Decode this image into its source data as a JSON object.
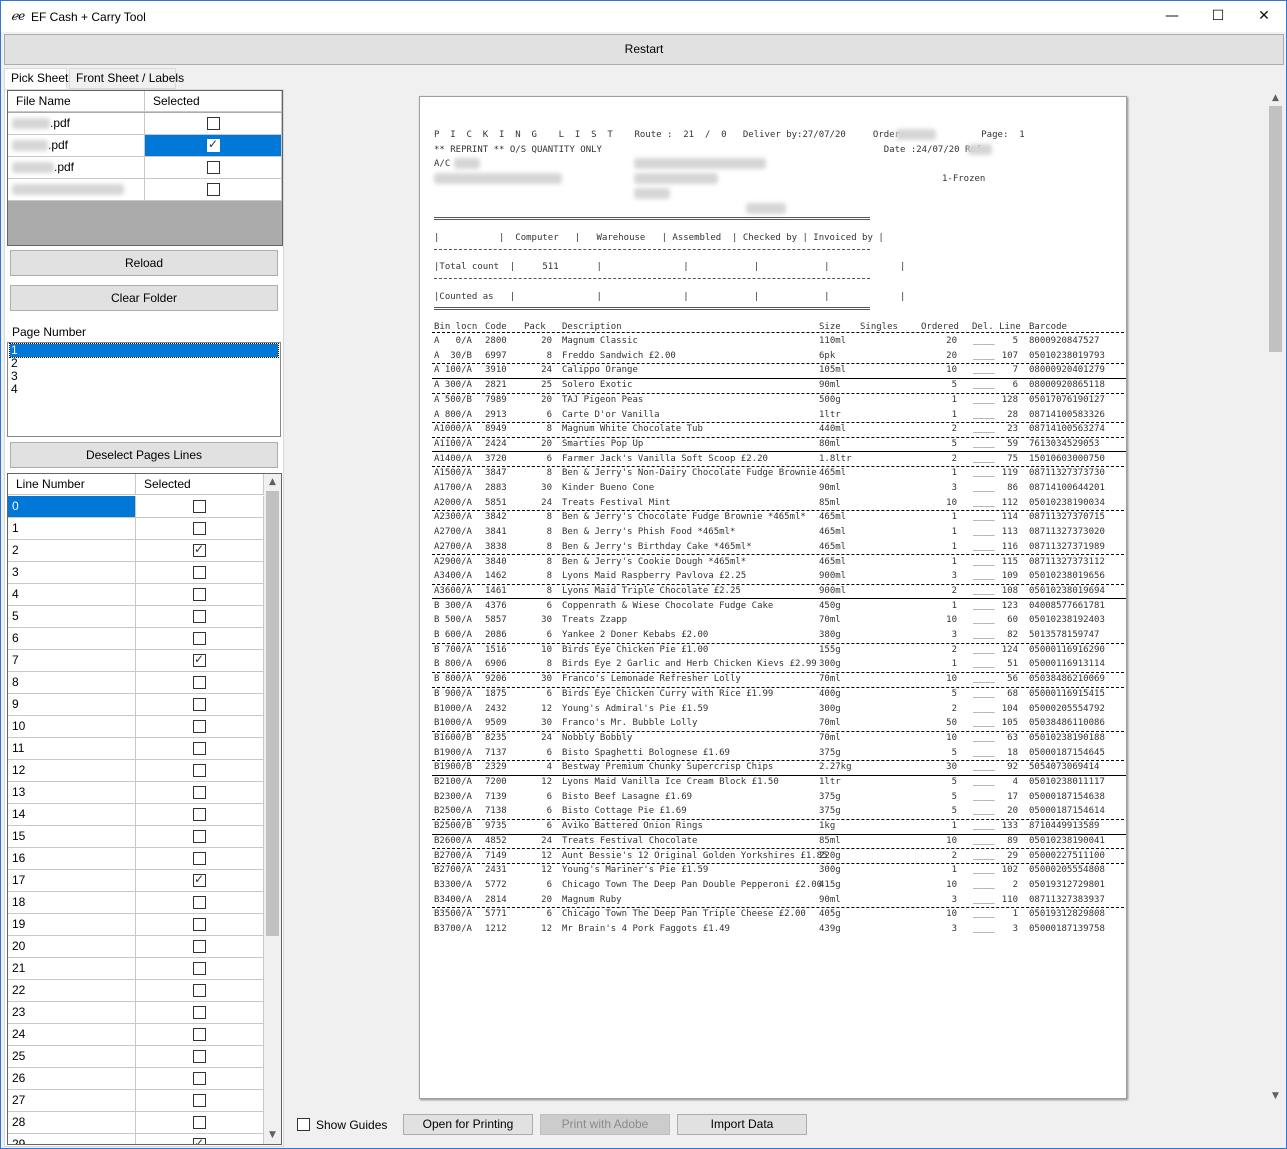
{
  "window": {
    "app_icon": "ℯe",
    "title": "EF Cash + Carry Tool",
    "minimize_icon": "—",
    "maximize_icon": "☐",
    "close_icon": "✕"
  },
  "toolbar": {
    "restart_label": "Restart"
  },
  "tabs": [
    {
      "label": "Pick Sheet",
      "active": true
    },
    {
      "label": "Front Sheet / Labels",
      "active": false
    }
  ],
  "files_grid": {
    "headers": [
      "File Name",
      "Selected"
    ],
    "rows": [
      {
        "name": ".pdf",
        "selected": false
      },
      {
        "name": ".pdf",
        "selected": true
      },
      {
        "name": ".pdf",
        "selected": false
      },
      {
        "name": "",
        "selected": false
      }
    ]
  },
  "buttons": {
    "reload": "Reload",
    "clear_folder": "Clear Folder",
    "deselect": "Deselect Pages Lines",
    "open_printing": "Open for Printing",
    "print_adobe": "Print with Adobe",
    "import_data": "Import Data"
  },
  "pages": {
    "label": "Page Number",
    "items": [
      "1",
      "2",
      "3",
      "4"
    ],
    "selected_index": 0
  },
  "lines_grid": {
    "headers": [
      "Line Number",
      "Selected"
    ],
    "checked": [
      2,
      7,
      17,
      29
    ],
    "selected_row": 0
  },
  "show_guides": {
    "label": "Show Guides",
    "checked": false
  },
  "document": {
    "header_line1": "P  I  C  K  I  N  G    L  I  S  T    Route :  21  /  0   Deliver by:27/07/20     Order:              Page:  1",
    "header_line2": "** REPRINT ** O/S QUANTITY ONLY                                                    Date :24/07/20 Ref:",
    "header_line3": "A/C",
    "frozen": "1-Frozen",
    "summary_header": "|           |  Computer   |   Warehouse   | Assembled  | Checked by | Invoiced by |",
    "summary_total": "|Total count  |     511       |               |            |            |             |",
    "summary_counted": "|Counted as   |               |               |            |            |             |",
    "columns": [
      "Bin locn",
      "Code",
      "Pack",
      "Description",
      "Size",
      "Singles",
      "Ordered",
      "Del. Line",
      "Barcode"
    ],
    "rows": [
      [
        "A   0/A",
        "2800",
        "20",
        "Magnum Classic",
        "110ml",
        "20",
        "5",
        "8000920847527"
      ],
      [
        "A  30/B",
        "6997",
        "8",
        "Freddo Sandwich £2.00",
        "6pk",
        "20",
        "107",
        "05010238019793"
      ],
      [
        "A 100/A",
        "3910",
        "24",
        "Calippo Orange",
        "105ml",
        "10",
        "7",
        "08000920401279"
      ],
      [
        "A 300/A",
        "2821",
        "25",
        "Solero Exotic",
        "90ml",
        "5",
        "6",
        "08000920865118"
      ],
      [
        "A 500/B",
        "7989",
        "20",
        "TAJ Pigeon Peas",
        "500g",
        "1",
        "128",
        "05017076190127"
      ],
      [
        "A 800/A",
        "2913",
        "6",
        "Carte D'or Vanilla",
        "1ltr",
        "1",
        "28",
        "08714100583326"
      ],
      [
        "A1000/A",
        "8949",
        "8",
        "Magnum White Chocolate Tub",
        "440ml",
        "2",
        "23",
        "08714100563274"
      ],
      [
        "A1100/A",
        "2424",
        "20",
        "Smarties Pop Up",
        "80ml",
        "5",
        "59",
        "7613034529053"
      ],
      [
        "A1400/A",
        "3720",
        "6",
        "Farmer Jack's Vanilla Soft Scoop £2.20",
        "1.8ltr",
        "2",
        "75",
        "15010603000750"
      ],
      [
        "A1500/A",
        "3847",
        "8",
        "Ben & Jerry's Non-Dairy Chocolate Fudge Brownie",
        "465ml",
        "1",
        "119",
        "08711327373730"
      ],
      [
        "A1700/A",
        "2883",
        "30",
        "Kinder Bueno Cone",
        "90ml",
        "3",
        "86",
        "08714100644201"
      ],
      [
        "A2000/A",
        "5851",
        "24",
        "Treats Festival Mint",
        "85ml",
        "10",
        "112",
        "05010238190034"
      ],
      [
        "A2300/A",
        "3842",
        "8",
        "Ben & Jerry's Chocolate Fudge Brownie *465ml*",
        "465ml",
        "1",
        "114",
        "08711327370715"
      ],
      [
        "A2700/A",
        "3841",
        "8",
        "Ben & Jerry's Phish Food *465ml*",
        "465ml",
        "1",
        "113",
        "08711327373020"
      ],
      [
        "A2700/A",
        "3838",
        "8",
        "Ben & Jerry's Birthday Cake *465ml*",
        "465ml",
        "1",
        "116",
        "08711327371989"
      ],
      [
        "A2900/A",
        "3840",
        "8",
        "Ben & Jerry's Cookie Dough *465ml*",
        "465ml",
        "1",
        "115",
        "08711327373112"
      ],
      [
        "A3400/A",
        "1462",
        "8",
        "Lyons Maid Raspberry Pavlova £2.25",
        "900ml",
        "3",
        "109",
        "05010238019656"
      ],
      [
        "A3600/A",
        "1461",
        "8",
        "Lyons Maid Triple Chocolate £2.25",
        "900ml",
        "2",
        "108",
        "05010238019694"
      ],
      [
        "B 300/A",
        "4376",
        "6",
        "Coppenrath & Wiese Chocolate Fudge Cake",
        "450g",
        "1",
        "123",
        "04008577661781"
      ],
      [
        "B 500/A",
        "5857",
        "30",
        "Treats Zzapp",
        "70ml",
        "10",
        "60",
        "05010238192403"
      ],
      [
        "B 600/A",
        "2086",
        "6",
        "Yankee 2 Doner Kebabs £2.00",
        "380g",
        "3",
        "82",
        "5013578159747"
      ],
      [
        "B 700/A",
        "1516",
        "10",
        "Birds Eye Chicken Pie £1.00",
        "155g",
        "2",
        "124",
        "05000116916290"
      ],
      [
        "B 800/A",
        "6906",
        "8",
        "Birds Eye 2 Garlic and Herb Chicken Kievs £2.99",
        "300g",
        "1",
        "51",
        "05000116913114"
      ],
      [
        "B 800/A",
        "9206",
        "30",
        "Franco's Lemonade Refresher Lolly",
        "70ml",
        "10",
        "56",
        "05038486210069"
      ],
      [
        "B 900/A",
        "1875",
        "6",
        "Birds Eye Chicken Curry with Rice £1.99",
        "400g",
        "5",
        "68",
        "05000116915415"
      ],
      [
        "B1000/A",
        "2432",
        "12",
        "Young's Admiral's Pie £1.59",
        "300g",
        "2",
        "104",
        "05000205554792"
      ],
      [
        "B1000/A",
        "9509",
        "30",
        "Franco's Mr. Bubble Lolly",
        "70ml",
        "50",
        "105",
        "05038486110086"
      ],
      [
        "B1600/B",
        "8235",
        "24",
        "Nobbly Bobbly",
        "70ml",
        "10",
        "63",
        "05010238190188"
      ],
      [
        "B1900/A",
        "7137",
        "6",
        "Bisto Spaghetti Bolognese £1.69",
        "375g",
        "5",
        "18",
        "05000187154645"
      ],
      [
        "B1900/B",
        "2329",
        "4",
        "Bestway Premium Chunky Supercrisp Chips",
        "2.27kg",
        "30",
        "92",
        "5054073069414"
      ],
      [
        "B2100/A",
        "7200",
        "12",
        "Lyons Maid Vanilla Ice Cream Block £1.50",
        "1ltr",
        "5",
        "4",
        "05010238011117"
      ],
      [
        "B2300/A",
        "7139",
        "6",
        "Bisto Beef Lasagne £1.69",
        "375g",
        "5",
        "17",
        "05000187154638"
      ],
      [
        "B2500/A",
        "7138",
        "6",
        "Bisto Cottage Pie £1.69",
        "375g",
        "5",
        "20",
        "05000187154614"
      ],
      [
        "B2500/B",
        "9735",
        "6",
        "Aviko Battered Onion Rings",
        "1kg",
        "1",
        "133",
        "8710449913589"
      ],
      [
        "B2600/A",
        "4852",
        "24",
        "Treats Festival Chocolate",
        "85ml",
        "10",
        "89",
        "05010238190041"
      ],
      [
        "B2700/A",
        "7149",
        "12",
        "Aunt Bessie's 12 Original Golden Yorkshires £1.85",
        "220g",
        "2",
        "29",
        "05000227511100"
      ],
      [
        "B2700/A",
        "2431",
        "12",
        "Young's Mariner's Pie £1.59",
        "300g",
        "1",
        "102",
        "05000205554808"
      ],
      [
        "B3300/A",
        "5772",
        "6",
        "Chicago Town The Deep Pan Double Pepperoni £2.00",
        "415g",
        "10",
        "2",
        "05019312729801"
      ],
      [
        "B3400/A",
        "2814",
        "20",
        "Magnum Ruby",
        "90ml",
        "3",
        "110",
        "08711327383937"
      ],
      [
        "B3500/A",
        "5771",
        "6",
        "Chicago Town The Deep Pan Triple Cheese £2.00",
        "405g",
        "10",
        "1",
        "05019312829808"
      ],
      [
        "B3700/A",
        "1212",
        "12",
        "Mr Brain's 4 Pork Faggots £1.49",
        "439g",
        "3",
        "3",
        "05000187139758"
      ]
    ]
  }
}
